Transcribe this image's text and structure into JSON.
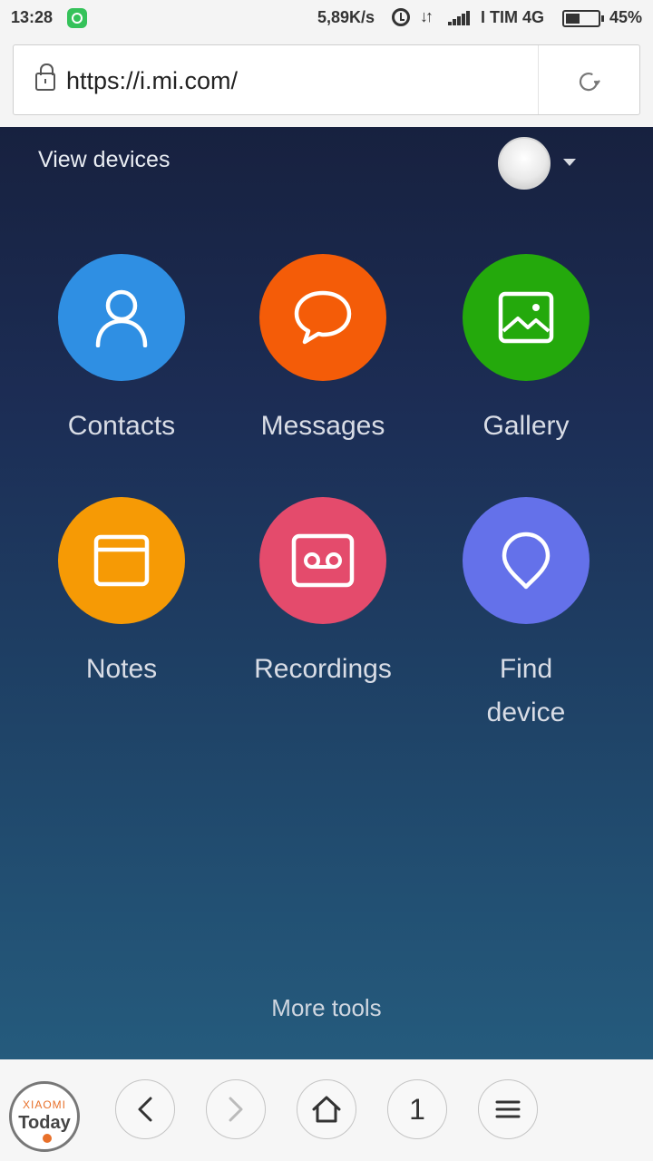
{
  "status_bar": {
    "time": "13:28",
    "speed": "5,89K/s",
    "carrier": "I TIM 4G",
    "battery_pct": "45%",
    "battery_level": 0.45
  },
  "browser": {
    "url": "https://i.mi.com/"
  },
  "header": {
    "view_devices": "View devices"
  },
  "apps": [
    {
      "label": "Contacts",
      "color": "#2f8fe3",
      "icon": "person-icon"
    },
    {
      "label": "Messages",
      "color": "#f45c08",
      "icon": "speech-bubble-icon"
    },
    {
      "label": "Gallery",
      "color": "#24a90c",
      "icon": "image-icon"
    },
    {
      "label": "Notes",
      "color": "#f69a05",
      "icon": "notes-icon"
    },
    {
      "label": "Recordings",
      "color": "#e44b6c",
      "icon": "cassette-icon"
    },
    {
      "label": "Find device",
      "color": "#6471ea",
      "icon": "location-pin-icon"
    }
  ],
  "footer": {
    "more_tools": "More tools"
  },
  "bottom_nav": {
    "tab_count": "1",
    "logo_top": "XIAOMI",
    "logo_bottom": "Today",
    "buttons": [
      "back-icon",
      "forward-icon",
      "home-icon",
      "tabs-count",
      "menu-icon"
    ]
  }
}
